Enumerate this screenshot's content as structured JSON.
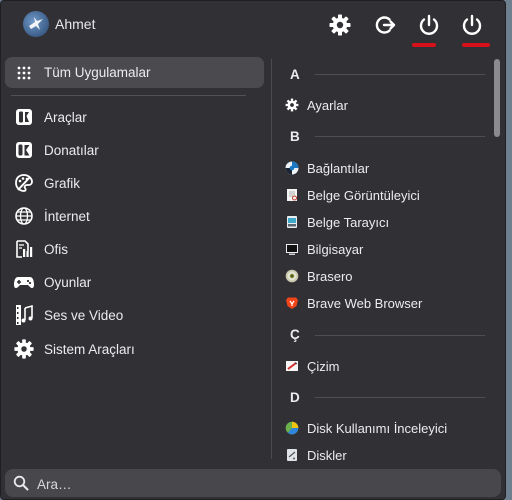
{
  "user": {
    "name": "Ahmet",
    "avatar_icon": "bird-avatar-icon"
  },
  "header_buttons": [
    {
      "name": "settings-button",
      "icon": "gear-icon"
    },
    {
      "name": "logout-button",
      "icon": "logout-icon"
    },
    {
      "name": "suspend-button",
      "icon": "power-icon"
    },
    {
      "name": "shutdown-button",
      "icon": "power-icon"
    }
  ],
  "highlight_color": "#d6111b",
  "categories": {
    "all": "Tüm Uygulamalar",
    "items": [
      "Araçlar",
      "Donatılar",
      "Grafik",
      "İnternet",
      "Ofis",
      "Oyunlar",
      "Ses ve Video",
      "Sistem Araçları"
    ]
  },
  "app_list": {
    "sections": [
      {
        "letter": "A",
        "apps": [
          "Ayarlar"
        ]
      },
      {
        "letter": "B",
        "apps": [
          "Bağlantılar",
          "Belge Görüntüleyici",
          "Belge Tarayıcı",
          "Bilgisayar",
          "Brasero",
          "Brave Web Browser"
        ]
      },
      {
        "letter": "Ç",
        "apps": [
          "Çizim"
        ]
      },
      {
        "letter": "D",
        "apps": [
          "Disk Kullanımı İnceleyici",
          "Diskler"
        ]
      }
    ]
  },
  "search": {
    "placeholder": "Ara…"
  }
}
